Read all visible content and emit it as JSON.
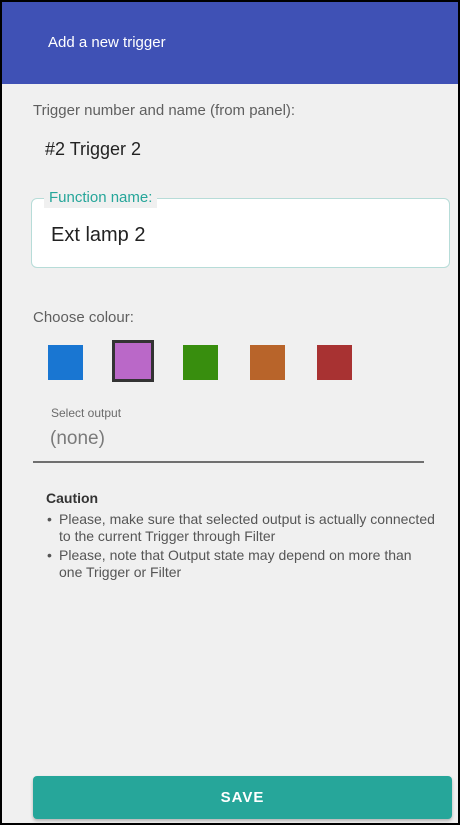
{
  "appbar": {
    "title": "Add a new trigger",
    "color": "#3f51b5"
  },
  "trigger": {
    "label": "Trigger number and name (from panel):",
    "value": "#2 Trigger 2"
  },
  "function_name": {
    "legend": "Function name:",
    "value": "Ext lamp 2",
    "accent_color": "#26a69a"
  },
  "colour": {
    "label": "Choose colour:",
    "swatches": [
      {
        "color": "#1976d2",
        "selected": false
      },
      {
        "color": "#ba68c8",
        "selected": true
      },
      {
        "color": "#388e0e",
        "selected": false
      },
      {
        "color": "#b8642a",
        "selected": false
      },
      {
        "color": "#a83232",
        "selected": false
      }
    ]
  },
  "output": {
    "label": "Select output",
    "value": "(none)"
  },
  "caution": {
    "title": "Caution",
    "items": [
      "Please, make sure that selected output is actually connected to the current Trigger through Filter",
      "Please, note that Output state may depend on more than one Trigger or Filter"
    ]
  },
  "save_button": {
    "label": "SAVE",
    "color": "#26a69a"
  }
}
